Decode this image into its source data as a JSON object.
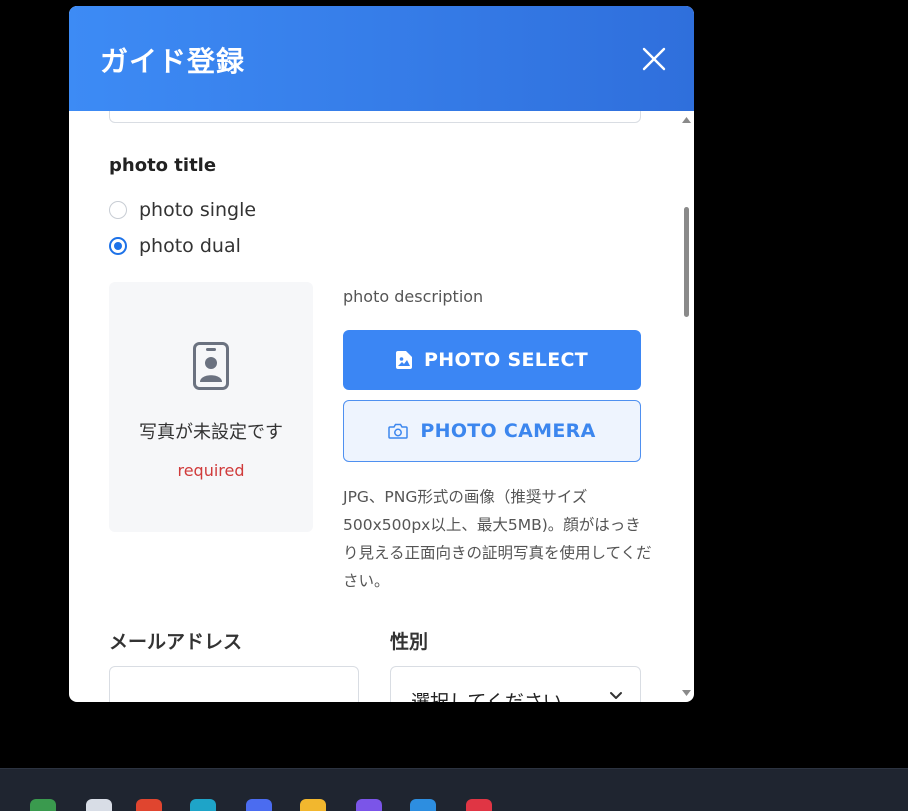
{
  "dialog": {
    "title": "ガイド登録",
    "close_icon": "close-icon"
  },
  "photo_section": {
    "label": "photo title",
    "options": [
      {
        "label": "photo single",
        "checked": false
      },
      {
        "label": "photo dual",
        "checked": true
      }
    ],
    "preview": {
      "icon": "id-badge-icon",
      "status": "写真が未設定です",
      "required": "required"
    },
    "description": "photo description",
    "select_button": {
      "label": "PHOTO SELECT",
      "icon": "image-file-icon"
    },
    "camera_button": {
      "label": "PHOTO CAMERA",
      "icon": "camera-icon"
    },
    "hint": "JPG、PNG形式の画像（推奨サイズ500x500px以上、最大5MB)。顔がはっきり見える正面向きの証明写真を使用してください。"
  },
  "email": {
    "label": "メールアドレス",
    "value": "",
    "placeholder": ""
  },
  "gender": {
    "label": "性別",
    "selected": "選択してください"
  },
  "colors": {
    "header": "#3d8bf5",
    "primary": "#3b86f4",
    "required": "#d03b3b"
  }
}
